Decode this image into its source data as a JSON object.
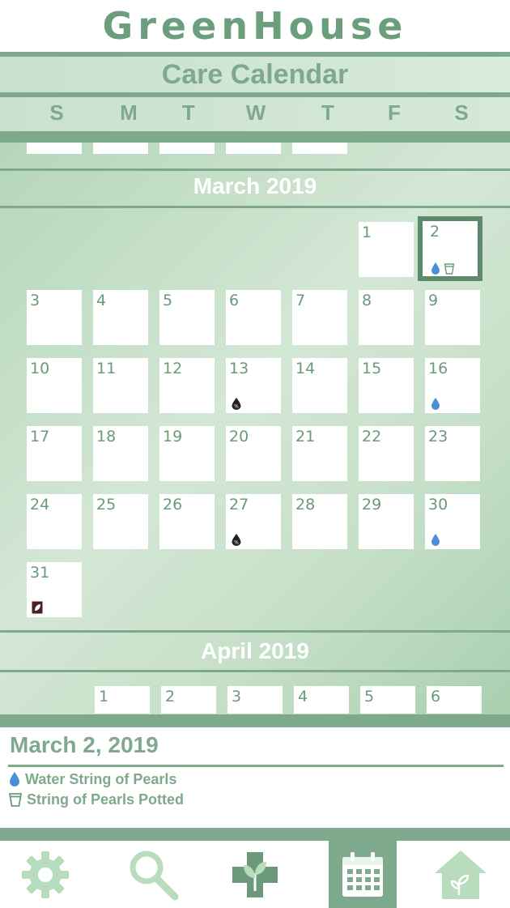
{
  "app": {
    "name": "GreenHouse"
  },
  "page": {
    "title": "Care Calendar"
  },
  "weekdays": [
    "S",
    "M",
    "T",
    "W",
    "T",
    "F",
    "S"
  ],
  "months": [
    {
      "title": "March 2019",
      "days": [
        "1",
        "2",
        "3",
        "4",
        "5",
        "6",
        "7",
        "8",
        "9",
        "10",
        "11",
        "12",
        "13",
        "14",
        "15",
        "16",
        "17",
        "18",
        "19",
        "20",
        "21",
        "22",
        "23",
        "24",
        "25",
        "26",
        "27",
        "28",
        "29",
        "30",
        "31"
      ]
    },
    {
      "title": "April 2019",
      "days": [
        "1",
        "2",
        "3",
        "4",
        "5",
        "6"
      ]
    }
  ],
  "markers": {
    "2": [
      "water-drop",
      "pot"
    ],
    "13": [
      "fertilizer"
    ],
    "16": [
      "water-drop"
    ],
    "27": [
      "fertilizer"
    ],
    "30": [
      "water-drop"
    ],
    "31": [
      "leaf"
    ]
  },
  "selected": {
    "date": "March 2, 2019",
    "day": "2",
    "events": [
      {
        "icon": "water-drop-icon",
        "text": "Water String of Pearls"
      },
      {
        "icon": "pot-icon",
        "text": "String of Pearls Potted"
      }
    ]
  },
  "tabs": [
    {
      "name": "settings",
      "icon": "gear-icon",
      "active": false
    },
    {
      "name": "search",
      "icon": "search-icon",
      "active": false
    },
    {
      "name": "plant-care",
      "icon": "plant-cross-icon",
      "active": false
    },
    {
      "name": "calendar",
      "icon": "calendar-icon",
      "active": true
    },
    {
      "name": "home",
      "icon": "house-plant-icon",
      "active": false
    }
  ],
  "colors": {
    "accent": "#7ea98d",
    "drop": "#4a90d9",
    "fertilizer": "#222222",
    "leaf": "#4a2020"
  }
}
